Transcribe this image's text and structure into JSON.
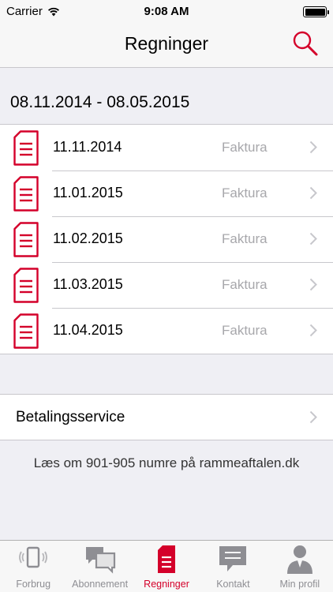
{
  "colors": {
    "accent": "#d4002a",
    "background": "#efeff4",
    "secondary_text": "#a7a7ab"
  },
  "status_bar": {
    "carrier": "Carrier",
    "time": "9:08 AM"
  },
  "nav": {
    "title": "Regninger",
    "search_icon": "search-icon"
  },
  "period": "08.11.2014 - 08.05.2015",
  "invoices": [
    {
      "date": "11.11.2014",
      "type": "Faktura"
    },
    {
      "date": "11.01.2015",
      "type": "Faktura"
    },
    {
      "date": "11.02.2015",
      "type": "Faktura"
    },
    {
      "date": "11.03.2015",
      "type": "Faktura"
    },
    {
      "date": "11.04.2015",
      "type": "Faktura"
    }
  ],
  "betalingsservice": {
    "label": "Betalingsservice"
  },
  "info_text": "Læs om 901-905 numre på rammeaftalen.dk",
  "tabs": [
    {
      "label": "Forbrug",
      "icon": "phone-icon",
      "active": false
    },
    {
      "label": "Abonnement",
      "icon": "chat-bubbles-icon",
      "active": false
    },
    {
      "label": "Regninger",
      "icon": "document-icon",
      "active": true
    },
    {
      "label": "Kontakt",
      "icon": "chat-bubble-icon",
      "active": false
    },
    {
      "label": "Min profil",
      "icon": "person-icon",
      "active": false
    }
  ]
}
